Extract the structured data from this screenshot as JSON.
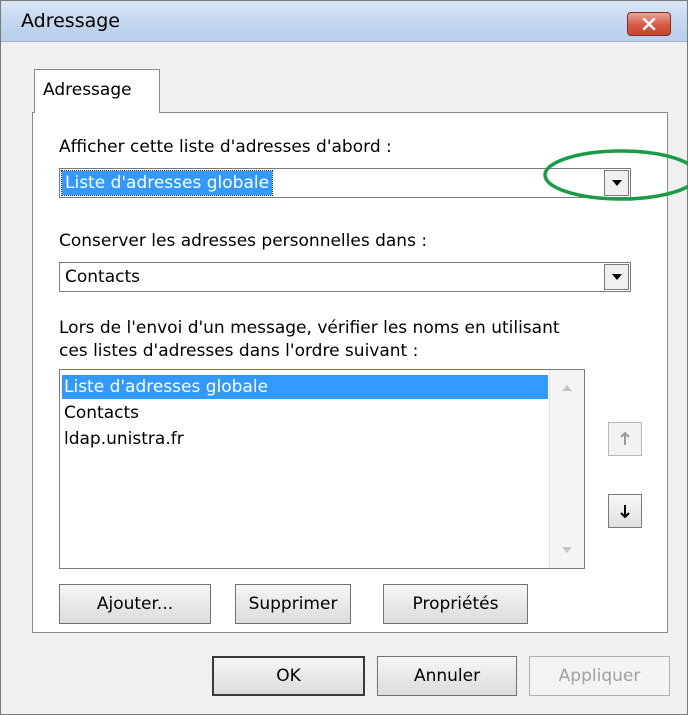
{
  "window": {
    "title": "Adressage"
  },
  "tabs": [
    {
      "label": "Adressage"
    }
  ],
  "first_list": {
    "label": "Afficher cette liste d'adresses d'abord :",
    "value": "Liste d'adresses globale"
  },
  "personal": {
    "label": "Conserver les adresses personnelles dans :",
    "value": "Contacts"
  },
  "check_names": {
    "label_line1": "Lors de l'envoi d'un message, vérifier les noms en utilisant",
    "label_line2": "ces listes d'adresses dans l'ordre suivant :",
    "items": [
      {
        "label": "Liste d'adresses globale",
        "selected": true
      },
      {
        "label": "Contacts",
        "selected": false
      },
      {
        "label": "ldap.unistra.fr",
        "selected": false
      }
    ]
  },
  "list_buttons": {
    "add": "Ajouter...",
    "remove": "Supprimer",
    "properties": "Propriétés"
  },
  "footer_buttons": {
    "ok": "OK",
    "cancel": "Annuler",
    "apply": "Appliquer"
  },
  "colors": {
    "selection": "#3399ff",
    "annotation": "#1a9c45",
    "close_button": "#c8442f"
  }
}
